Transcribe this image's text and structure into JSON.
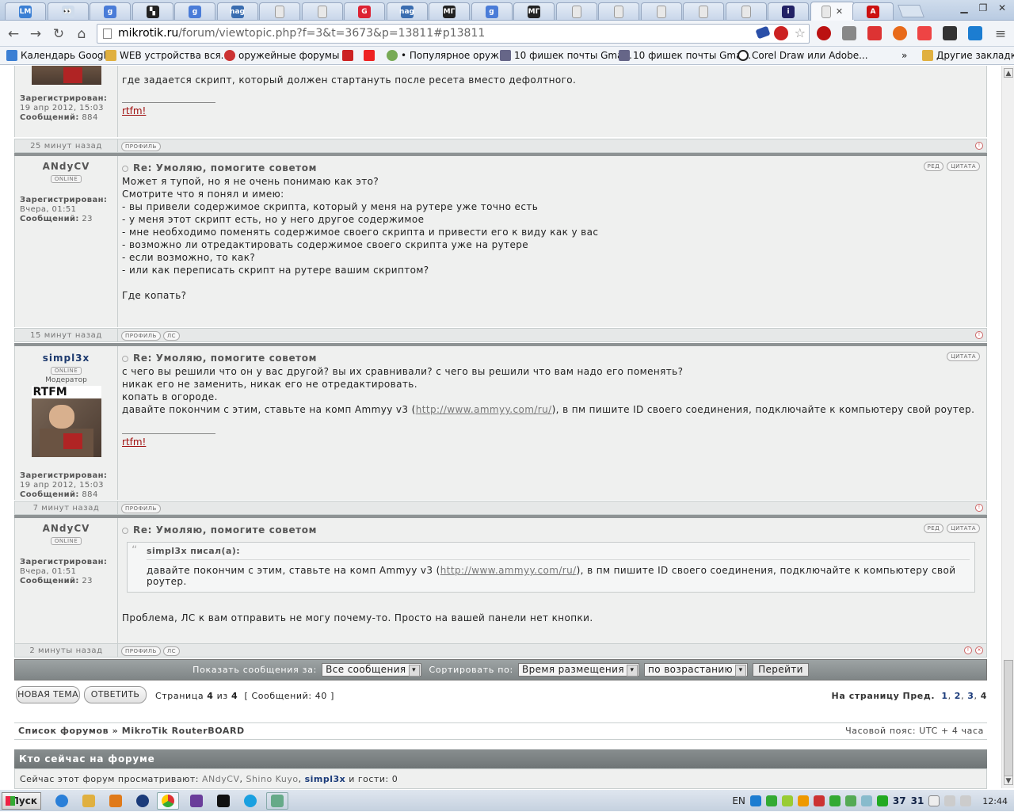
{
  "browser": {
    "tabs": [
      {
        "label": "LM",
        "color": "#3b7fd4"
      },
      {
        "label": "👀",
        "color": "#cfdcec"
      },
      {
        "label": "g",
        "color": "#4a7cd8"
      },
      {
        "label": "▚",
        "color": "#222"
      },
      {
        "label": "g",
        "color": "#4a7cd8"
      },
      {
        "label": "nag",
        "color": "#3a6db0"
      },
      {
        "label": "",
        "color": "#e8e8e8"
      },
      {
        "label": "",
        "color": "#e8e8e8"
      },
      {
        "label": "G",
        "color": "#d23"
      },
      {
        "label": "nag",
        "color": "#3a6db0"
      },
      {
        "label": "МГ",
        "color": "#222"
      },
      {
        "label": "g",
        "color": "#4a7cd8"
      },
      {
        "label": "МГ",
        "color": "#222"
      },
      {
        "label": "",
        "color": "#e8e8e8"
      },
      {
        "label": "",
        "color": "#e8e8e8"
      },
      {
        "label": "",
        "color": "#e8e8e8"
      },
      {
        "label": "",
        "color": "#e8e8e8"
      },
      {
        "label": "",
        "color": "#e8e8e8"
      },
      {
        "label": "i",
        "color": "#226"
      },
      {
        "label": "",
        "color": "#e8e8e8"
      },
      {
        "label": "A",
        "color": "#c11"
      }
    ],
    "url_host": "mikrotik.ru",
    "url_path": "/forum/viewtopic.php?f=3&t=3673&p=13811#p13811",
    "bookmarks": [
      {
        "label": "Календарь Google",
        "color": "#3b7fd4"
      },
      {
        "label": "WEB устройства вся...",
        "color": "#e0b040"
      },
      {
        "label": "оружейные форумы ...",
        "color": "#c33"
      },
      {
        "label": "",
        "color": "#c22"
      },
      {
        "label": "",
        "color": "#e22"
      },
      {
        "label": "• Популярное оружие",
        "color": "#7a5"
      },
      {
        "label": "10 фишек почты Gma...",
        "color": "#668"
      },
      {
        "label": "10 фишек почты Gma...",
        "color": "#668"
      },
      {
        "label": "Corel Draw или Adobe...",
        "color": "#222"
      }
    ],
    "bookmarks_more": "»",
    "other_bookmarks": "Другие закладки"
  },
  "posts": [
    {
      "partial": true,
      "text_lines": [
        "где задается скрипт, который должен стартануть после ресета вместо дефолтного."
      ],
      "registered_label": "Зарегистрирован:",
      "registered": "19 апр 2012, 15:03",
      "messages_label": "Сообщений:",
      "messages": "884",
      "signature": "rtfm!",
      "ago": "25 минут назад",
      "foot_buttons": [
        "ПРОФИЛЬ"
      ]
    },
    {
      "username": "ANdyCV",
      "status": "ONLINE",
      "title": "Re: Умоляю, помогите советом",
      "buttons": [
        "РЕД",
        "ЦИТАТА"
      ],
      "text_lines": [
        "Может я тупой, но я не очень понимаю как это?",
        "Смотрите что я понял и имею:",
        "- вы привели содержимое скрипта, который у меня на рутере уже точно есть",
        "- у меня этот скрипт есть, но у него другое содержимое",
        "- мне необходимо поменять содержимое своего скрипта и привести его к виду как у вас",
        "- возможно ли отредактировать содержимое своего скрипта уже на рутере",
        "- если возможно, то как?",
        "- или как переписать скрипт на рутере вашим скриптом?",
        "",
        "Где копать?"
      ],
      "registered_label": "Зарегистрирован:",
      "registered": "Вчера, 01:51",
      "messages_label": "Сообщений:",
      "messages": "23",
      "ago": "15 минут назад",
      "foot_buttons": [
        "ПРОФИЛЬ",
        "ЛС"
      ]
    },
    {
      "username": "simpl3x",
      "status": "ONLINE",
      "rank": "Модератор",
      "avatar_label": "RTFM",
      "title": "Re: Умоляю, помогите советом",
      "buttons": [
        "ЦИТАТА"
      ],
      "text_lines": [
        "с чего вы решили что он у вас другой? вы их сравнивали? с чего вы решили что вам надо его поменять?",
        "никак его не заменить, никак его не отредактировать.",
        "копать в огороде."
      ],
      "text_link_prefix": "давайте покончим с этим, ставьте на комп Ammyy v3 (",
      "text_link": "http://www.ammyy.com/ru/",
      "text_link_suffix": "), в пм пишите ID своего соединения, подключайте к компьютеру свой роутер.",
      "signature": "rtfm!",
      "registered_label": "Зарегистрирован:",
      "registered": "19 апр 2012, 15:03",
      "messages_label": "Сообщений:",
      "messages": "884",
      "ago": "7 минут назад",
      "foot_buttons": [
        "ПРОФИЛЬ"
      ]
    },
    {
      "username": "ANdyCV",
      "status": "ONLINE",
      "title": "Re: Умоляю, помогите советом",
      "buttons": [
        "РЕД",
        "ЦИТАТА"
      ],
      "quote_author": "simpl3x писал(а):",
      "quote_prefix": "давайте покончим с этим, ставьте на комп Ammyy v3 (",
      "quote_link": "http://www.ammyy.com/ru/",
      "quote_suffix": "), в пм пишите ID своего соединения, подключайте к компьютеру свой роутер.",
      "text_after": "Проблема, ЛС к вам отправить не могу почему-то. Просто на вашей панели нет кнопки.",
      "registered_label": "Зарегистрирован:",
      "registered": "Вчера, 01:51",
      "messages_label": "Сообщений:",
      "messages": "23",
      "ago": "2 минуты назад",
      "foot_buttons": [
        "ПРОФИЛЬ",
        "ЛС"
      ]
    }
  ],
  "sortbar": {
    "show_label": "Показать сообщения за:",
    "show_value": "Все сообщения",
    "sort_label": "Сортировать по:",
    "sort_value": "Время размещения",
    "order_value": "по возрастанию",
    "go": "Перейти"
  },
  "actions": {
    "new_topic": "НОВАЯ ТЕМА",
    "reply": "ОТВЕТИТЬ"
  },
  "pageinfo": {
    "page_word": "Страница",
    "current": "4",
    "of_word": "из",
    "total": "4",
    "messages": "[ Сообщений: 40 ]"
  },
  "pagenav": {
    "label": "На страницу",
    "prev": "Пред.",
    "pages": [
      "1",
      "2",
      "3"
    ],
    "current": "4"
  },
  "breadcrumb": {
    "forums": "Список форумов",
    "sep": "»",
    "board": "MikroTik RouterBOARD",
    "timezone": "Часовой пояс: UTC + 4 часа"
  },
  "whoisonline": {
    "title": "Кто сейчас на форуме",
    "prefix": "Сейчас этот форум просматривают:",
    "users": [
      "ANdyCV",
      "Shino Kuyo"
    ],
    "moderator": "simpl3x",
    "guests": "и гости: 0"
  },
  "taskbar": {
    "start": "Пуск",
    "lang": "EN",
    "tray_num1": "37",
    "tray_num2": "31",
    "clock": "12:44"
  }
}
